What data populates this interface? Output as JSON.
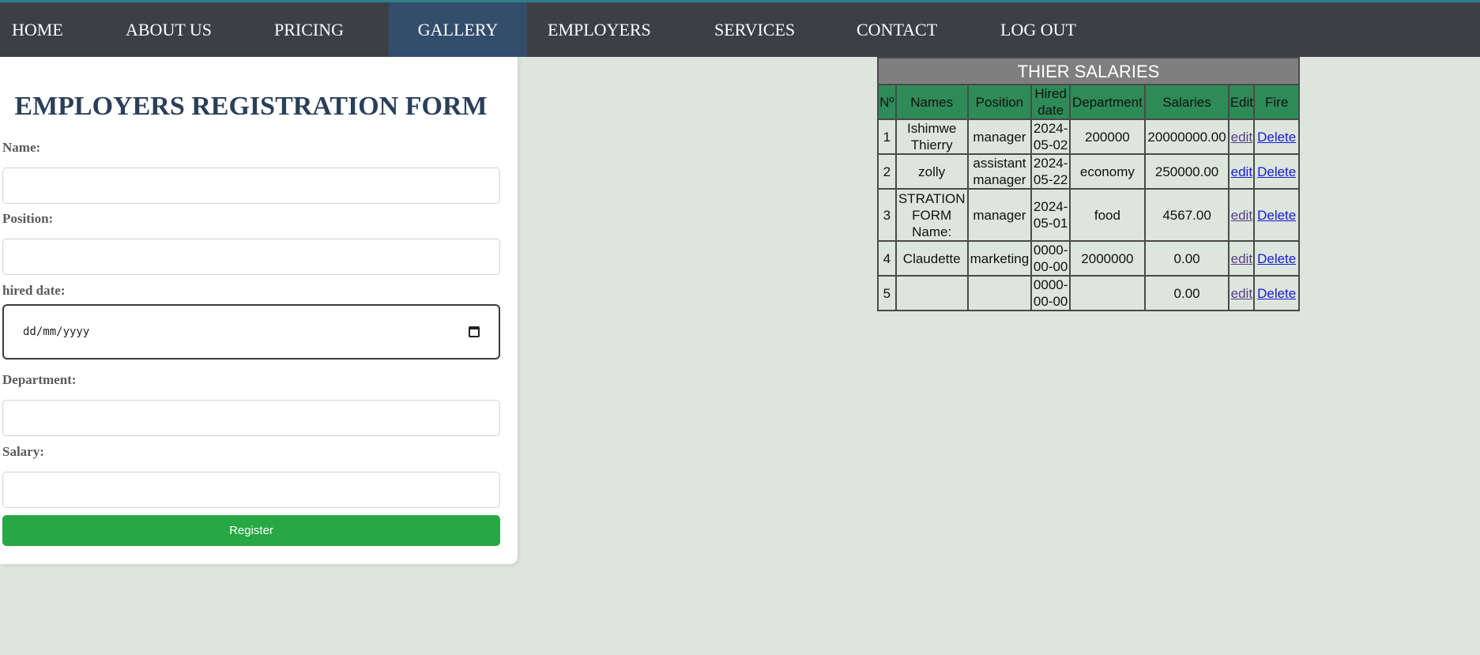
{
  "nav": {
    "items": [
      {
        "label": "HOME"
      },
      {
        "label": "ABOUT US"
      },
      {
        "label": "PRICING"
      },
      {
        "label": "GALLERY"
      },
      {
        "label": "EMPLOYERS"
      },
      {
        "label": "SERVICES"
      },
      {
        "label": "CONTACT"
      },
      {
        "label": "LOG OUT"
      }
    ],
    "active": "GALLERY"
  },
  "form": {
    "title": "EMPLOYERS REGISTRATION FORM",
    "name_label": "Name:",
    "name_value": "",
    "position_label": "Position:",
    "position_value": "",
    "hired_date_label": "hired date:",
    "hired_date_placeholder": "dd/mm/yyyy",
    "department_label": "Department:",
    "department_value": "",
    "salary_label": "Salary:",
    "salary_value": "",
    "register_label": "Register"
  },
  "table": {
    "caption": "THIER SALARIES",
    "headers": [
      "Nº",
      "Names",
      "Position",
      "Hired date",
      "Department",
      "Salaries",
      "Edit",
      "Fire"
    ],
    "rows": [
      {
        "no": "1",
        "name": "Ishimwe Thierry",
        "position": "manager",
        "hired": "2024-05-02",
        "department": "200000",
        "salary": "20000000.00",
        "edit": "edit",
        "fire": "Delete"
      },
      {
        "no": "2",
        "name": "zolly",
        "position": "assistant manager",
        "hired": "2024-05-22",
        "department": "economy",
        "salary": "250000.00",
        "edit": "edit",
        "fire": "Delete"
      },
      {
        "no": "3",
        "name": "STRATION FORM Name:",
        "position": "manager",
        "hired": "2024-05-01",
        "department": "food",
        "salary": "4567.00",
        "edit": "edit",
        "fire": "Delete"
      },
      {
        "no": "4",
        "name": "Claudette",
        "position": "marketing",
        "hired": "0000-00-00",
        "department": "2000000",
        "salary": "0.00",
        "edit": "edit",
        "fire": "Delete"
      },
      {
        "no": "5",
        "name": "",
        "position": "",
        "hired": "0000-00-00",
        "department": "",
        "salary": "0.00",
        "edit": "edit",
        "fire": "Delete"
      }
    ]
  },
  "colors": {
    "nav_bg": "#3d3f47",
    "nav_active": "#344d6d",
    "page_bg": "#dce6dc",
    "header_green": "#2e8b57",
    "register_green": "#28a745",
    "caption_gray": "#7f7f7f"
  }
}
